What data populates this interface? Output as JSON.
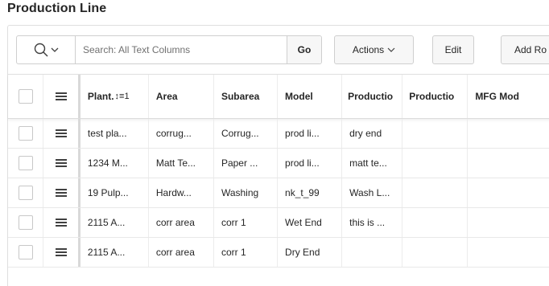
{
  "region": {
    "title": "Production Line"
  },
  "toolbar": {
    "search_placeholder": "Search: All Text Columns",
    "go_label": "Go",
    "actions_label": "Actions",
    "edit_label": "Edit",
    "add_label": "Add Ro"
  },
  "columns": {
    "plant": "Plant.",
    "area": "Area",
    "subarea": "Subarea",
    "model": "Model",
    "production1": "Productio",
    "production2": "Productio",
    "mfg_model": "MFG Mod"
  },
  "sort_indicator": "↕≡1",
  "rows": [
    {
      "plant": "test pla...",
      "area": "corrug...",
      "subarea": "Corrug...",
      "model": "prod li...",
      "production1": "dry end",
      "production2": "",
      "mfg_model": ""
    },
    {
      "plant": "1234 M...",
      "area": "Matt Te...",
      "subarea": "Paper ...",
      "model": "prod li...",
      "production1": "matt te...",
      "production2": "",
      "mfg_model": ""
    },
    {
      "plant": "19 Pulp...",
      "area": "Hardw...",
      "subarea": "Washing",
      "model": "nk_t_99",
      "production1": "Wash L...",
      "production2": "",
      "mfg_model": ""
    },
    {
      "plant": "2115 A...",
      "area": "corr area",
      "subarea": "corr 1",
      "model": "Wet End",
      "production1": "this is ...",
      "production2": "",
      "mfg_model": ""
    },
    {
      "plant": "2115 A...",
      "area": "corr area",
      "subarea": "corr 1",
      "model": "Dry End",
      "production1": "",
      "production2": "",
      "mfg_model": ""
    }
  ]
}
